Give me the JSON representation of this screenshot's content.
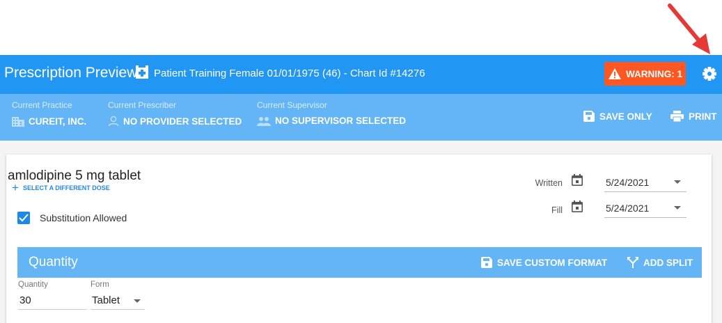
{
  "header": {
    "title": "Prescription Preview:",
    "patient": "Patient Training Female 01/01/1975 (46) - Chart Id #14276",
    "warning_label": "WARNING: 1",
    "icons": [
      "pharmacy-cross-icon",
      "warning-icon",
      "gear-icon"
    ],
    "colors": {
      "primary": "#2196f3",
      "secondary": "#64b5f6",
      "warning": "#ff5722",
      "arrow": "#e53935"
    }
  },
  "context": {
    "practice_label": "Current Practice",
    "practice_value": "CUREIT, INC.",
    "prescriber_label": "Current Prescriber",
    "prescriber_value": "NO PROVIDER SELECTED",
    "supervisor_label": "Current Supervisor",
    "supervisor_value": "NO SUPERVISOR SELECTED",
    "save_only": "SAVE ONLY",
    "print": "PRINT"
  },
  "drug": {
    "name": "amlodipine 5 mg tablet",
    "change_dose": "SELECT A DIFFERENT DOSE",
    "substitution_label": "Substitution Allowed",
    "substitution_checked": true
  },
  "dates": {
    "written_label": "Written",
    "written_value": "5/24/2021",
    "fill_label": "Fill",
    "fill_value": "5/24/2021"
  },
  "quantity": {
    "title": "Quantity",
    "save_custom_format": "SAVE CUSTOM FORMAT",
    "add_split": "ADD SPLIT",
    "quantity_label": "Quantity",
    "quantity_value": "30",
    "form_label": "Form",
    "form_value": "Tablet"
  }
}
